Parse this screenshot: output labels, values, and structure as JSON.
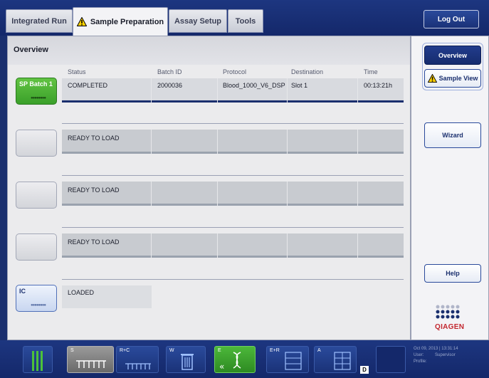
{
  "tabs": [
    {
      "label": "Integrated Run"
    },
    {
      "label": "Sample Preparation"
    },
    {
      "label": "Assay Setup"
    },
    {
      "label": "Tools"
    }
  ],
  "logout_label": "Log Out",
  "overview": {
    "title": "Overview",
    "columns": [
      "Status",
      "Batch ID",
      "Protocol",
      "Destination",
      "Time"
    ],
    "rows": [
      {
        "slot_label": "SP Batch 1",
        "status": "COMPLETED",
        "batch_id": "2000036",
        "protocol": "Blood_1000_V6_DSP",
        "destination": "Slot 1",
        "time": "00:13:21h"
      },
      {
        "slot_label": "",
        "status": "READY TO LOAD"
      },
      {
        "slot_label": "",
        "status": "READY TO LOAD"
      },
      {
        "slot_label": "",
        "status": "READY TO LOAD"
      }
    ],
    "ic": {
      "slot_label": "IC",
      "status": "LOADED"
    }
  },
  "right_panel": {
    "overview_btn": "Overview",
    "sample_view_btn": "Sample View",
    "wizard_btn": "Wizard",
    "help_btn": "Help",
    "logo_text": "QIAGEN"
  },
  "bottom_bar": {
    "slots": [
      {
        "label": "",
        "icon": "tube-rack-icon"
      },
      {
        "label": "S",
        "icon": "sample-tubes-icon"
      },
      {
        "label": "R+C",
        "icon": "reagent-icon"
      },
      {
        "label": "W",
        "icon": "waste-bin-icon"
      },
      {
        "label": "E",
        "icon": "eluate-dna-icon"
      },
      {
        "label": "E+R",
        "icon": "assay-plate-icon"
      },
      {
        "label": "A",
        "icon": "assay-grid-icon"
      },
      {
        "label": "",
        "icon": "empty-slot-icon"
      }
    ],
    "d_label": "D",
    "status": {
      "datetime": "Oct 09, 2013 | 13:31:14",
      "user_label": "User:",
      "user": "Supervisor",
      "profile_label": "Profile:"
    }
  }
}
